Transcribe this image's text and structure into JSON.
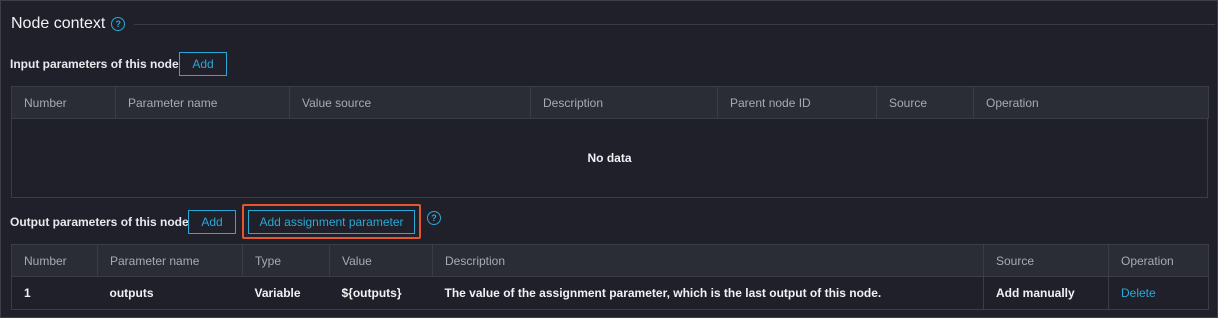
{
  "section": {
    "title": "Node context",
    "help_icon": "question-circle-icon"
  },
  "input": {
    "label": "Input parameters of this node",
    "add_label": "Add",
    "columns": [
      "Number",
      "Parameter name",
      "Value source",
      "Description",
      "Parent node ID",
      "Source",
      "Operation"
    ],
    "empty_text": "No data"
  },
  "output": {
    "label": "Output parameters of this node",
    "add_label": "Add",
    "add_assignment_label": "Add assignment parameter",
    "columns": [
      "Number",
      "Parameter name",
      "Type",
      "Value",
      "Description",
      "Source",
      "Operation"
    ],
    "rows": [
      {
        "number": "1",
        "name": "outputs",
        "type": "Variable",
        "value": "${outputs}",
        "description": "The value of the assignment parameter, which is the last output of this node.",
        "source": "Add manually",
        "operation": "Delete"
      }
    ]
  },
  "colors": {
    "accent": "#2aa8d8",
    "highlight": "#e4572e",
    "background": "#1f2029"
  }
}
